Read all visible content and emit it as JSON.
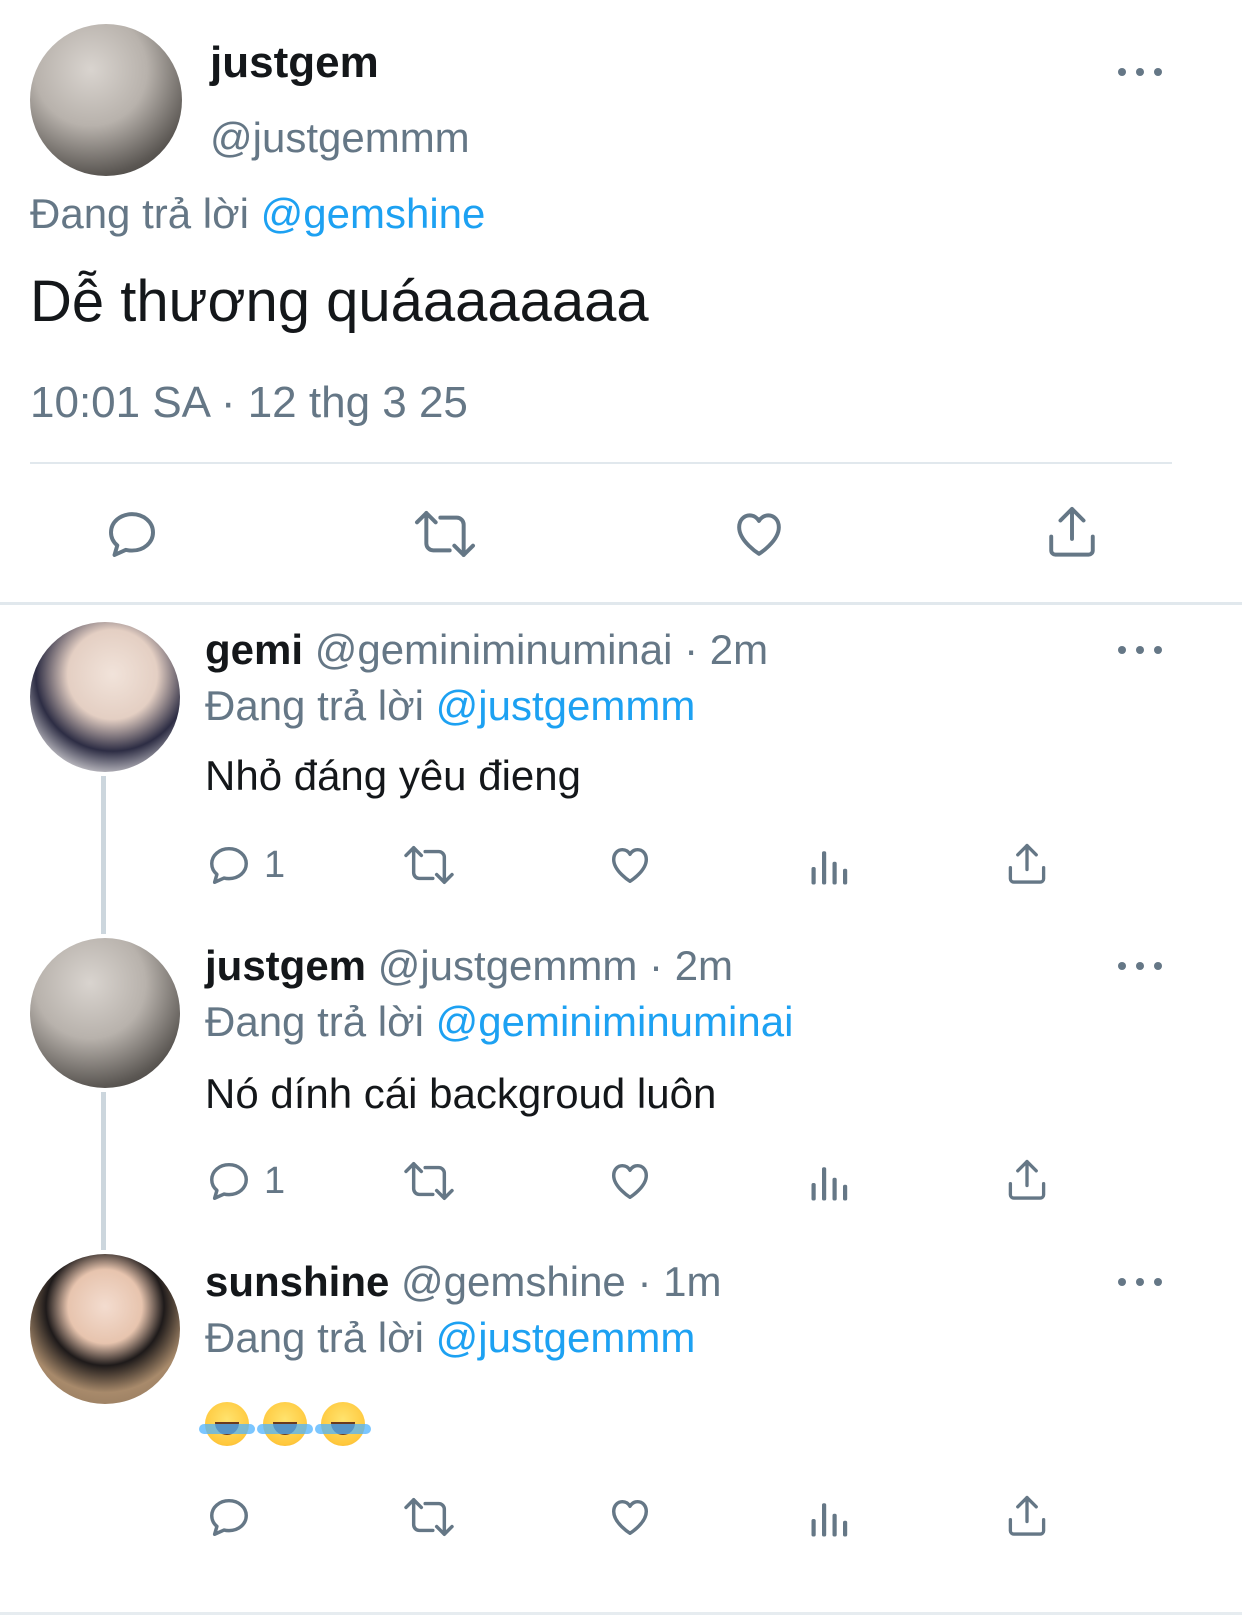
{
  "colors": {
    "text": "#14171a",
    "secondary": "#657786",
    "link": "#1da1f2",
    "divider": "#e1e8ed"
  },
  "main_tweet": {
    "display_name": "justgem",
    "handle": "@justgemmm",
    "reply_prefix": "Đang trả lời",
    "reply_to": "@gemshine",
    "text": "Dễ thương quáaaaaaaa",
    "timestamp": "10:01 SA · 12 thg 3 25",
    "actions": [
      "reply-icon",
      "retweet-icon",
      "like-icon",
      "share-icon"
    ]
  },
  "replies": [
    {
      "display_name": "gemi",
      "handle_time": "@geminiminuminai · 2m",
      "reply_prefix": "Đang trả lời",
      "reply_to": "@justgemmm",
      "text": "Nhỏ đáng yêu đieng",
      "reply_count": "1"
    },
    {
      "display_name": "justgem",
      "handle_time": "@justgemmm · 2m",
      "reply_prefix": "Đang trả lời",
      "reply_to": "@geminiminuminai",
      "text": "Nó dính cái backgroud luôn",
      "reply_count": "1"
    },
    {
      "display_name": "sunshine",
      "handle_time": "@gemshine · 1m",
      "reply_prefix": "Đang trả lời",
      "reply_to": "@justgemmm",
      "text": "😂😂😂",
      "reply_count": ""
    }
  ]
}
